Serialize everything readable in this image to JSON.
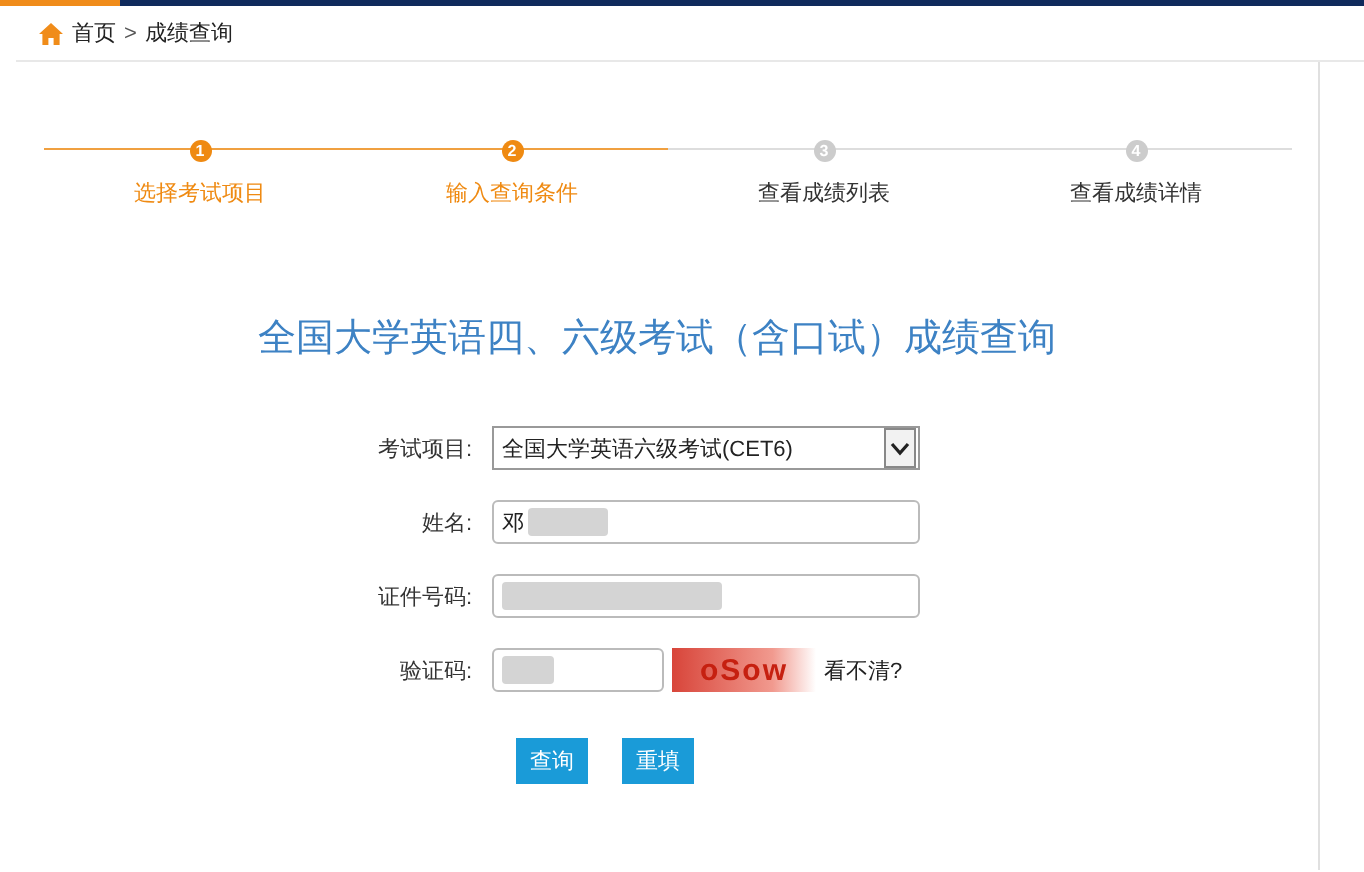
{
  "breadcrumb": {
    "home": "首页",
    "separator": ">",
    "current": "成绩查询"
  },
  "steps": [
    {
      "number": "1",
      "label": "选择考试项目",
      "active": true
    },
    {
      "number": "2",
      "label": "输入查询条件",
      "active": true
    },
    {
      "number": "3",
      "label": "查看成绩列表",
      "active": false
    },
    {
      "number": "4",
      "label": "查看成绩详情",
      "active": false
    }
  ],
  "title": "全国大学英语四、六级考试（含口试）成绩查询",
  "form": [
    {
      "kind": "select",
      "label": "考试项目:",
      "value": "全国大学英语六级考试(CET6)"
    },
    {
      "kind": "text",
      "label": "姓名:",
      "value": "邓",
      "blurred": true
    },
    {
      "kind": "text",
      "label": "证件号码:",
      "blurred": true
    },
    {
      "kind": "captcha",
      "label": "验证码:",
      "blurred": true,
      "captcha": "oSow",
      "refresh": "看不清?"
    }
  ],
  "buttons": [
    "查询",
    "重填"
  ]
}
